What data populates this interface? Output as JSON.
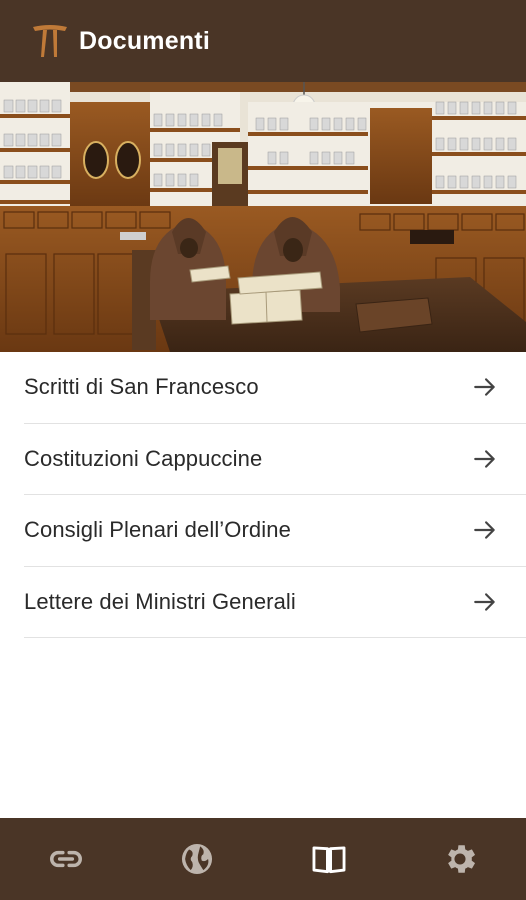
{
  "app_bar": {
    "title": "Documenti",
    "logo_icon": "tau-cross-logo",
    "background": "#4a3526",
    "logo_color": "#c07a38"
  },
  "hero": {
    "description": "friars-reading-in-old-pharmacy"
  },
  "documents": [
    {
      "label": "Scritti di San Francesco",
      "icon": "arrow-right-icon"
    },
    {
      "label": "Costituzioni Cappuccine",
      "icon": "arrow-right-icon"
    },
    {
      "label": "Consigli Plenari dell’Ordine",
      "icon": "arrow-right-icon"
    },
    {
      "label": "Lettere dei Ministri Generali",
      "icon": "arrow-right-icon"
    }
  ],
  "bottom_nav": {
    "items": [
      {
        "icon": "link-icon",
        "active": false
      },
      {
        "icon": "globe-icon",
        "active": false
      },
      {
        "icon": "book-icon",
        "active": true
      },
      {
        "icon": "gear-icon",
        "active": false
      }
    ],
    "active_color": "#ffffff",
    "inactive_color": "#bdb4ac"
  }
}
